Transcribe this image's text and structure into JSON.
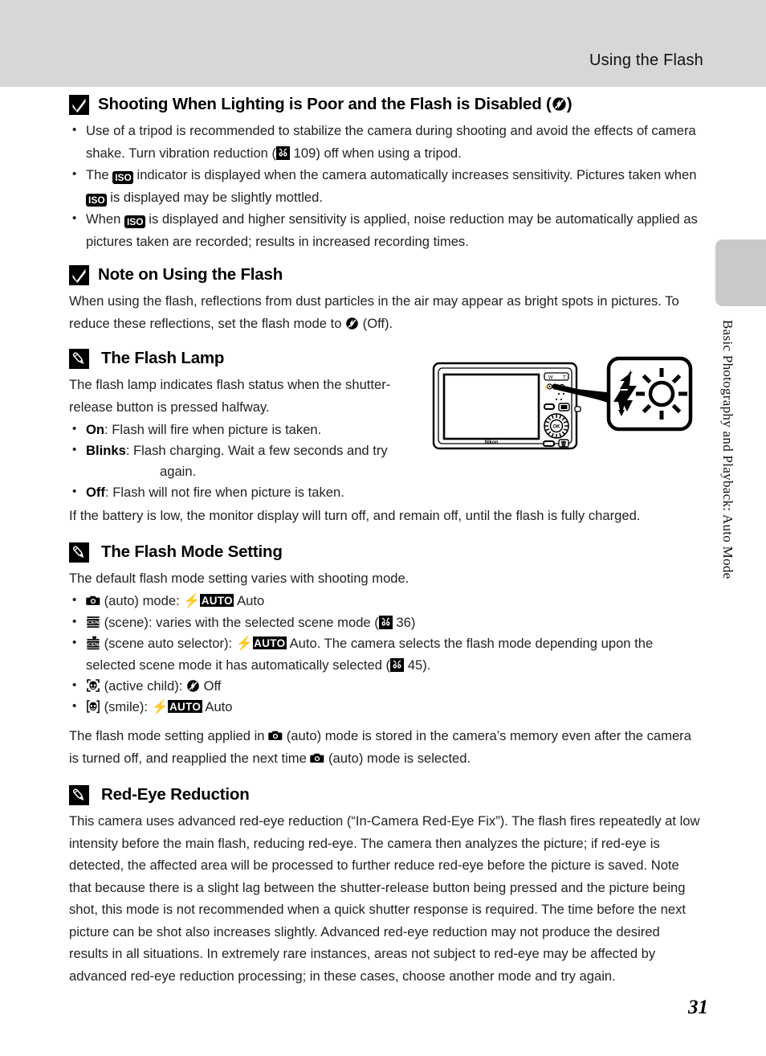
{
  "header": {
    "title": "Using the Flash"
  },
  "side_tab": {
    "label": "Basic Photography and Playback: Auto Mode"
  },
  "page_number": "31",
  "sections": [
    {
      "icon": "caution-check-icon",
      "title_pre": "Shooting When Lighting is Poor and the Flash is Disabled (",
      "title_post": ")",
      "bullets": [
        {
          "part1": "Use of a tripod is recommended to stabilize the camera during shooting and avoid the effects of camera shake. Turn vibration reduction (",
          "ref": "109",
          "part2": ") off when using a tripod."
        },
        {
          "part1": "The ",
          "part2": " indicator is displayed when the camera automatically increases sensitivity. Pictures taken when ",
          "part3": " is displayed may be slightly mottled."
        },
        {
          "part1": "When ",
          "part2": " is displayed and higher sensitivity is applied, noise reduction may be automatically applied as pictures taken are recorded; results in increased recording times."
        }
      ]
    },
    {
      "icon": "caution-check-icon",
      "title": "Note on Using the Flash",
      "para_pre": "When using the flash, reflections from dust particles in the air may appear as bright spots in pictures. To reduce these reflections, set the flash mode to ",
      "para_post": " (Off)."
    },
    {
      "icon": "note-pencil-icon",
      "title": "The Flash Lamp",
      "intro": "The flash lamp indicates flash status when the shutter-release button is pressed halfway.",
      "items": [
        {
          "label": "On",
          "sep": ": ",
          "text": "Flash will fire when picture is taken."
        },
        {
          "label": "Blinks",
          "sep": ":  ",
          "text": "Flash charging. Wait a few seconds and try",
          "text2": "again."
        },
        {
          "label": "Off",
          "sep": ": ",
          "text": "Flash will not fire when picture is taken."
        }
      ],
      "outro": "If the battery is low, the monitor display will turn off, and remain off, until the flash is fully charged."
    },
    {
      "icon": "note-pencil-icon",
      "title": "The Flash Mode Setting",
      "intro": "The default flash mode setting varies with shooting mode.",
      "modes": [
        {
          "icon": "auto-camera-icon",
          "text_pre": " (auto) mode: ",
          "flash": "AUTO",
          "text_post": " Auto"
        },
        {
          "icon": "scene-icon",
          "text_pre": " (scene): varies with the selected scene mode (",
          "ref": "36",
          "text_post": ")"
        },
        {
          "icon": "scene-auto-selector-icon",
          "text_pre": " (scene auto selector): ",
          "flash": "AUTO",
          "text_mid": " Auto. The camera selects the flash mode depending upon the selected scene mode it has automatically selected (",
          "ref": "45",
          "text_post": ")."
        },
        {
          "icon": "active-child-icon",
          "text_pre": " (active child): ",
          "flashoff": true,
          "text_post": " Off"
        },
        {
          "icon": "smile-icon",
          "text_pre": " (smile): ",
          "flash": "AUTO",
          "text_post": " Auto"
        }
      ],
      "outro_pre": "The flash mode setting applied in ",
      "outro_mid": " (auto) mode is stored in the camera’s memory even after the camera is turned off, and reapplied the next time ",
      "outro_post": " (auto) mode is selected."
    },
    {
      "icon": "note-pencil-icon",
      "title": "Red-Eye Reduction",
      "para": "This camera uses advanced red-eye reduction (“In-Camera Red-Eye Fix”). The flash fires repeatedly at low intensity before the main flash, reducing red-eye. The camera then analyzes the picture; if red-eye is detected, the affected area will be processed to further reduce red-eye before the picture is saved. Note that because there is a slight lag between the shutter-release button being pressed and the picture being shot, this mode is not recommended when a quick shutter response is required. The time before the next picture can be shot also increases slightly. Advanced red-eye reduction may not produce the desired results in all situations. In extremely rare instances, areas not subject to red-eye may be affected by advanced red-eye reduction processing; in these cases, choose another mode and try again."
    }
  ],
  "figure": {
    "name": "camera-rear-with-flash-lamp-callout",
    "brand": "Nikon",
    "callout": "flash-lamp-indicator"
  },
  "colors": {
    "header_band": "#d7d7d7",
    "side_tab": "#c9c9c9",
    "text": "#222222",
    "icon_box": "#000000"
  }
}
